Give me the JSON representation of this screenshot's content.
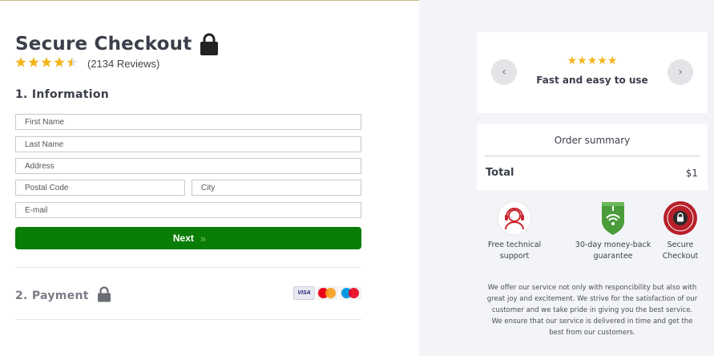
{
  "header": {
    "title": "Secure Checkout",
    "rating_value": 4.5,
    "stars": "★★★★★",
    "reviews": "(2134 Reviews)"
  },
  "information": {
    "heading": "1. Information",
    "fields": {
      "first_name": "First Name",
      "last_name": "Last Name",
      "address": "Address",
      "postal_code": "Postal Code",
      "city": "City",
      "email": "E-mail"
    },
    "next_label": "Next",
    "next_icon": "double-chevron-right-icon"
  },
  "payment": {
    "heading": "2. Payment",
    "cards": [
      "VISA",
      "MasterCard",
      "Maestro"
    ]
  },
  "testimonial": {
    "stars": "★★★★★",
    "text": "Fast and easy to use",
    "prev_icon": "‹",
    "next_icon": "›"
  },
  "order_summary": {
    "title": "Order summary",
    "total_label": "Total",
    "total_value": "$1"
  },
  "badges": [
    {
      "icon": "support-agent-icon",
      "line1": "Free technical",
      "line2": "support"
    },
    {
      "icon": "guarantee-shield-icon",
      "line1": "30-day money-back",
      "line2": "guarantee"
    },
    {
      "icon": "secure-checkout-seal-icon",
      "line1": "Secure",
      "line2": "Checkout"
    }
  ],
  "about_text": "We offer our service not only with responcibility but also with great joy and excitement. We strive for the satisfaction of our customer and we take pride in giving you the best service. We ensure that our service is delivered in time and get the best from our customers.",
  "colors": {
    "accent_green": "#0a7d06",
    "star_yellow": "#f3b51b",
    "panel_bg": "#f3f4f8"
  }
}
